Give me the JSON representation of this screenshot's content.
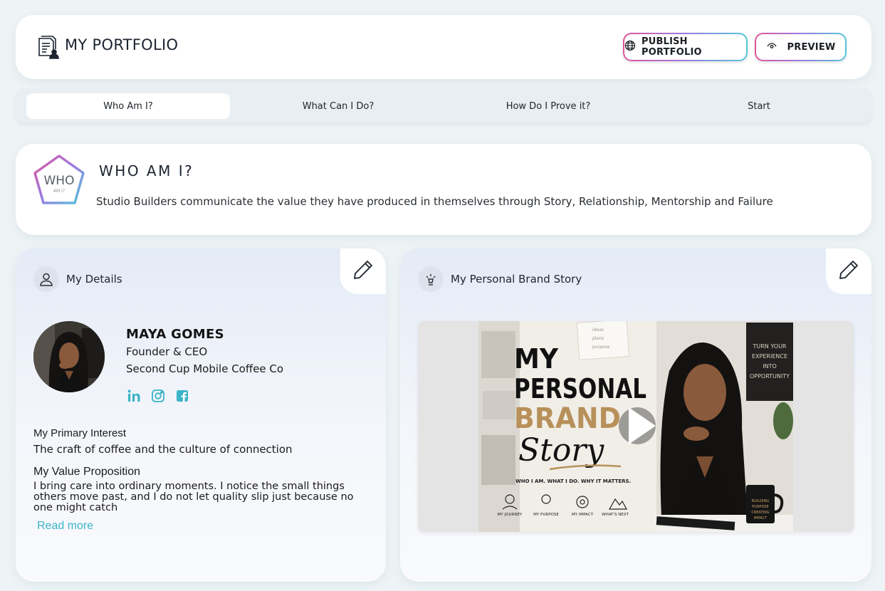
{
  "header": {
    "title": "MY PORTFOLIO",
    "publish_label": "PUBLISH PORTFOLIO",
    "preview_label": "PREVIEW"
  },
  "tabs": [
    {
      "label": "Who Am I?",
      "active": true
    },
    {
      "label": "What Can I Do?",
      "active": false
    },
    {
      "label": "How Do I Prove it?",
      "active": false
    },
    {
      "label": "Start",
      "active": false
    }
  ],
  "who": {
    "badge_title": "WHO",
    "badge_sub": "AM I?",
    "heading": "WHO AM I?",
    "description": "Studio Builders communicate the value they have produced in themselves through Story, Relationship, Mentorship and Failure"
  },
  "details": {
    "title": "My Details",
    "name": "MAYA GOMES",
    "role": "Founder & CEO",
    "company": "Second Cup Mobile Coffee Co",
    "socials": [
      "linkedin-icon",
      "instagram-icon",
      "facebook-icon"
    ],
    "primary_interest_label": "My Primary Interest",
    "primary_interest": "The craft of coffee and the culture of connection",
    "value_prop_label": "My Value Proposition",
    "value_prop": "I bring care into ordinary moments. I notice the small things others move past, and I do not let quality slip just because no one might catch",
    "read_more": "Read more"
  },
  "brand_story": {
    "title": "My Personal Brand Story",
    "thumb_line1": "MY",
    "thumb_line2": "PERSONAL",
    "thumb_line3": "BRAND",
    "thumb_line4": "Story",
    "thumb_tagline": "WHO I AM. WHAT I DO. WHY IT MATTERS.",
    "thumb_items": [
      "MY JOURNEY",
      "MY PURPOSE",
      "MY IMPACT",
      "WHAT'S NEXT"
    ],
    "poster_text": [
      "TURN YOUR",
      "EXPERIENCE",
      "INTO",
      "OPPORTUNITY"
    ],
    "mug_text": [
      "BUILDING",
      "PURPOSE",
      "CREATING",
      "IMPACT"
    ],
    "note_text": [
      "ideas",
      "plans",
      "purpose"
    ]
  },
  "colors": {
    "accent_pink": "#e0559b",
    "accent_purple": "#9a7be0",
    "accent_teal": "#53c7d9",
    "link": "#3bb3c8",
    "brand_gold": "#b8905a"
  }
}
